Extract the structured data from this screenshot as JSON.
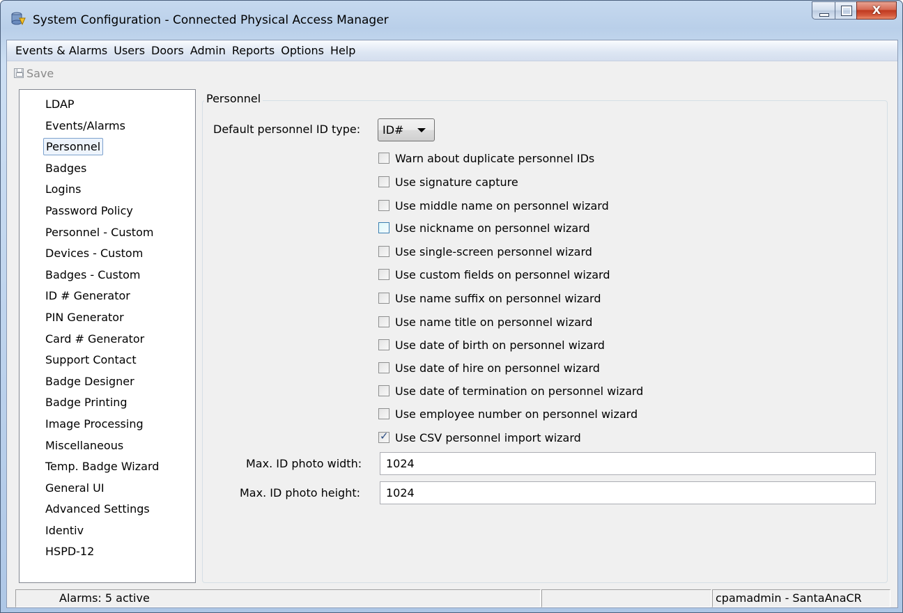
{
  "window": {
    "title": "System Configuration - Connected Physical Access Manager",
    "close_symbol": "X"
  },
  "menu": [
    "Events & Alarms",
    "Users",
    "Doors",
    "Admin",
    "Reports",
    "Options",
    "Help"
  ],
  "toolbar": {
    "save_label": "Save"
  },
  "nav": {
    "selected": "Personnel",
    "items": [
      "LDAP",
      "Events/Alarms",
      "Personnel",
      "Badges",
      "Logins",
      "Password Policy",
      "Personnel - Custom",
      "Devices - Custom",
      "Badges - Custom",
      "ID # Generator",
      "PIN Generator",
      "Card # Generator",
      "Support Contact",
      "Badge Designer",
      "Badge Printing",
      "Image Processing",
      "Miscellaneous",
      "Temp. Badge Wizard",
      "General UI",
      "Advanced Settings",
      "Identiv",
      "HSPD-12"
    ]
  },
  "personnel": {
    "group_title": "Personnel",
    "id_type_label": "Default personnel ID type:",
    "id_type_value": "ID#",
    "options": [
      {
        "label": "Warn about duplicate personnel IDs",
        "checked": false
      },
      {
        "label": "Use signature capture",
        "checked": false
      },
      {
        "label": "Use middle name on personnel wizard",
        "checked": false
      },
      {
        "label": "Use nickname on personnel wizard",
        "checked": false,
        "hover": true
      },
      {
        "label": "Use single-screen personnel wizard",
        "checked": false
      },
      {
        "label": "Use custom fields on personnel wizard",
        "checked": false
      },
      {
        "label": "Use name suffix on personnel wizard",
        "checked": false
      },
      {
        "label": "Use name title on personnel wizard",
        "checked": false
      },
      {
        "label": "Use date of birth on personnel wizard",
        "checked": false
      },
      {
        "label": "Use date of hire on personnel wizard",
        "checked": false
      },
      {
        "label": "Use date of termination on personnel wizard",
        "checked": false
      },
      {
        "label": "Use employee number on personnel wizard",
        "checked": false
      },
      {
        "label": "Use CSV personnel import wizard",
        "checked": true
      }
    ],
    "photo_width_label": "Max. ID photo width:",
    "photo_width_value": "1024",
    "photo_height_label": "Max. ID photo height:",
    "photo_height_value": "1024"
  },
  "status": {
    "alarms": "Alarms: 5 active",
    "middle": "",
    "user": "cpamadmin - SantaAnaCR"
  }
}
